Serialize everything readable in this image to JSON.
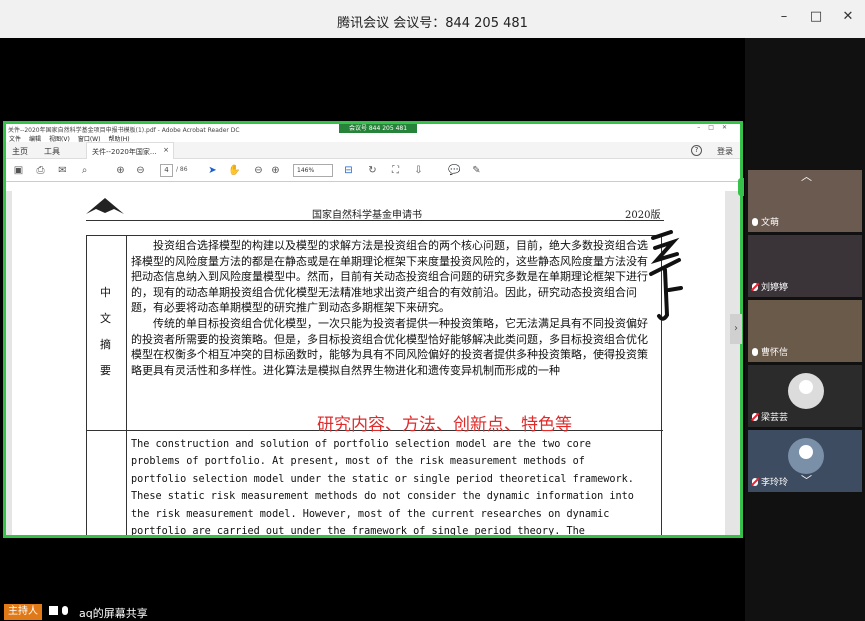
{
  "window": {
    "title": "腾讯会议 会议号：844 205 481",
    "controls": [
      "–",
      "□",
      "✕"
    ]
  },
  "acrobat": {
    "title_text": "关件--2020年国家自然科学基金项目申报书模板(1).pdf - Adobe Acrobat Reader DC",
    "meeting_badge": "会议号 844 205 481",
    "menu": [
      "文件",
      "编辑",
      "视图(V)",
      "窗口(W)",
      "帮助(H)"
    ],
    "tabs": {
      "home": "主页",
      "tools": "工具",
      "doc": "关件--2020年国家...",
      "doc_close": "×",
      "help": "?",
      "login": "登录"
    },
    "toolbar": {
      "page_current": "4",
      "page_total": "/ 86",
      "zoom": "146%"
    }
  },
  "document": {
    "header_title": "国家自然科学基金申请书",
    "header_year": "2020版",
    "label_chars": [
      "中",
      "文",
      "摘",
      "要"
    ],
    "cn_abstract": "　　投资组合选择模型的构建以及模型的求解方法是投资组合的两个核心问题，目前，绝大多数投资组合选择模型的风险度量方法的都是在静态或是在单期理论框架下来度量投资风险的，这些静态风险度量方法没有把动态信息纳入到风险度量模型中。然而，目前有关动态投资组合问题的研究多数是在单期理论框架下进行的，现有的动态单期投资组合优化模型无法精准地求出资产组合的有效前沿。因此，研究动态投资组合问题，有必要将动态单期模型的研究推广到动态多期框架下来研究。\n　　传统的单目标投资组合优化模型，一次只能为投资者提供一种投资策略，它无法满足具有不同投资偏好的投资者所需要的投资策略。但是，多目标投资组合优化模型恰好能够解决此类问题，多目标投资组合优化模型在权衡多个相互冲突的目标函数时，能够为具有不同风险偏好的投资者提供多种投资策略，使得投资策略更具有灵活性和多样性。进化算法是模拟自然界生物进化和遗传变异机制而形成的一种",
    "en_abstract": "The construction and solution of portfolio selection model are the two core\nproblems of portfolio. At present, most of the risk measurement methods of\nportfolio selection model under the static or single period theoretical framework.\nThese static risk measurement methods do not consider the dynamic information into\nthe risk measurement model. However, most of the current researches on dynamic\nportfolio are carried out under the framework of single period theory. The",
    "annotation": "研究内容、方法、创新点、特色等"
  },
  "participants": [
    {
      "name": "文萌",
      "mic": "on"
    },
    {
      "name": "刘婷婷",
      "mic": "off"
    },
    {
      "name": "曹怀信",
      "mic": "on"
    },
    {
      "name": "梁芸芸",
      "mic": "off"
    },
    {
      "name": "李玲玲",
      "mic": "off"
    }
  ],
  "bottom": {
    "host_label": "主持人",
    "share_text": "aq的屏幕共享"
  },
  "colors": {
    "share_border": "#36c24a",
    "annotation": "#e02b2b",
    "host_badge": "#e07a18"
  }
}
